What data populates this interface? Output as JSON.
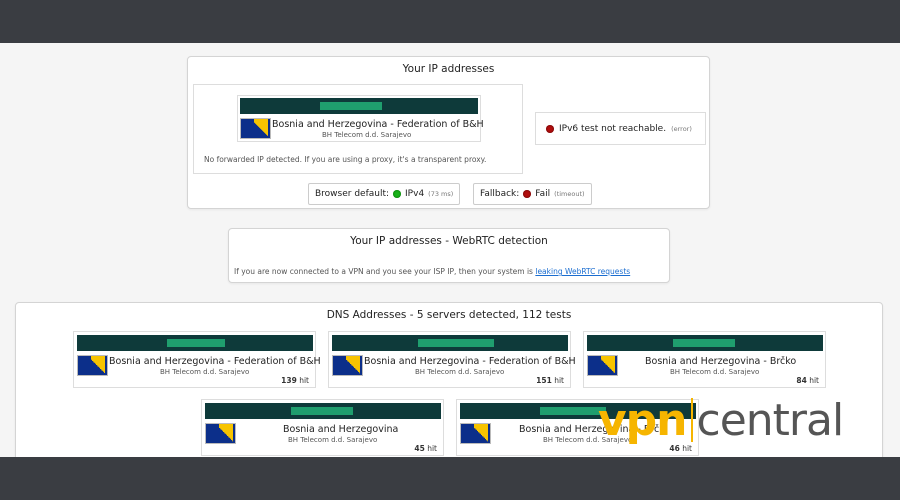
{
  "ip_panel": {
    "title": "Your IP addresses",
    "country": "Bosnia and Herzegovina - Federation of B&H",
    "isp": "BH Telecom d.d. Sarajevo",
    "forward_note": "No forwarded IP detected. If you are using a proxy, it's a transparent proxy.",
    "ipv6_text": "IPv6 test not reachable.",
    "ipv6_small": "(error)",
    "browser_default_label": "Browser default:",
    "browser_default_value": "IPv4",
    "browser_default_small": "(73 ms)",
    "fallback_label": "Fallback:",
    "fallback_value": "Fail",
    "fallback_small": "(timeout)"
  },
  "webrtc_panel": {
    "title": "Your IP addresses - WebRTC detection",
    "note_prefix": "If you are now connected to a VPN and you see your ISP IP, then your system is",
    "link_text": "leaking WebRTC requests"
  },
  "dns_panel": {
    "title": "DNS Addresses - 5 servers detected, 112 tests",
    "servers": [
      {
        "country": "Bosnia and Herzegovina - Federation of B&H",
        "isp": "BH Telecom d.d. Sarajevo",
        "hits": "139",
        "hit_label": "hit"
      },
      {
        "country": "Bosnia and Herzegovina - Federation of B&H",
        "isp": "BH Telecom d.d. Sarajevo",
        "hits": "151",
        "hit_label": "hit"
      },
      {
        "country": "Bosnia and Herzegovina - Brčko",
        "isp": "BH Telecom d.d. Sarajevo",
        "hits": "84",
        "hit_label": "hit"
      },
      {
        "country": "Bosnia and Herzegovina",
        "isp": "BH Telecom d.d. Sarajevo",
        "hits": "45",
        "hit_label": "hit"
      },
      {
        "country": "Bosnia and Herzegovina - Brčl",
        "isp": "BH Telecom d.d. Sarajevo",
        "hits": "46",
        "hit_label": "hit"
      }
    ]
  },
  "watermark": {
    "vpn": "vpn",
    "central": "central"
  },
  "colors": {
    "redact_bg": "#0e3a3a",
    "redact_green": "#1f9e6e",
    "status_red": "#b30e0e",
    "status_green": "#19b319",
    "link": "#1a6dd0",
    "watermark_accent": "#f6b500"
  }
}
